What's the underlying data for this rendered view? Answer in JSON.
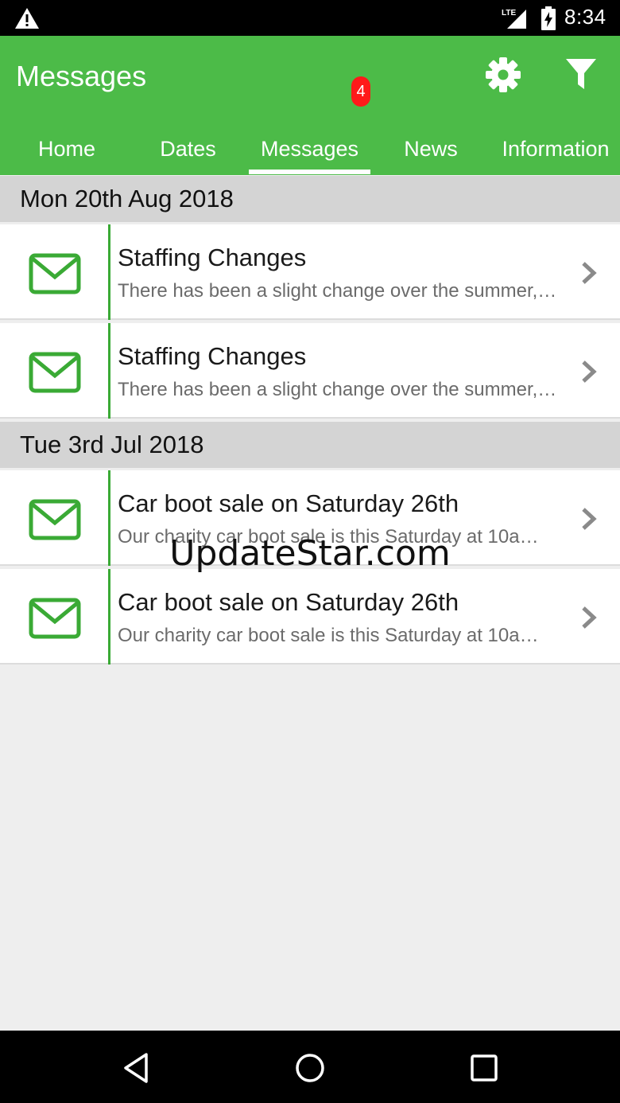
{
  "status_bar": {
    "time": "8:34",
    "network_label": "LTE"
  },
  "app_bar": {
    "title": "Messages",
    "accent_color": "#4cbb48"
  },
  "tabs": [
    {
      "label": "Home"
    },
    {
      "label": "Dates"
    },
    {
      "label": "Messages",
      "selected": true,
      "badge": "4"
    },
    {
      "label": "News"
    },
    {
      "label": "Information"
    }
  ],
  "sections": [
    {
      "date": "Mon 20th Aug 2018",
      "messages": [
        {
          "title": "Staffing Changes",
          "preview": "There has been a slight change over the summer,…"
        },
        {
          "title": "Staffing Changes",
          "preview": "There has been a slight change over the summer,…"
        }
      ]
    },
    {
      "date": "Tue 3rd Jul 2018",
      "messages": [
        {
          "title": "Car boot sale on Saturday 26th",
          "preview": "Our charity car boot sale is this Saturday at 10a…"
        },
        {
          "title": "Car boot sale on Saturday 26th",
          "preview": "Our charity car boot sale is this Saturday at 10a…"
        }
      ]
    }
  ],
  "watermark": "UpdateStar.com",
  "icons": [
    "warning-icon",
    "signal-icon",
    "battery-icon",
    "settings-icon",
    "filter-icon",
    "envelope-icon",
    "chevron-right-icon",
    "back-icon",
    "home-icon",
    "recents-icon"
  ]
}
